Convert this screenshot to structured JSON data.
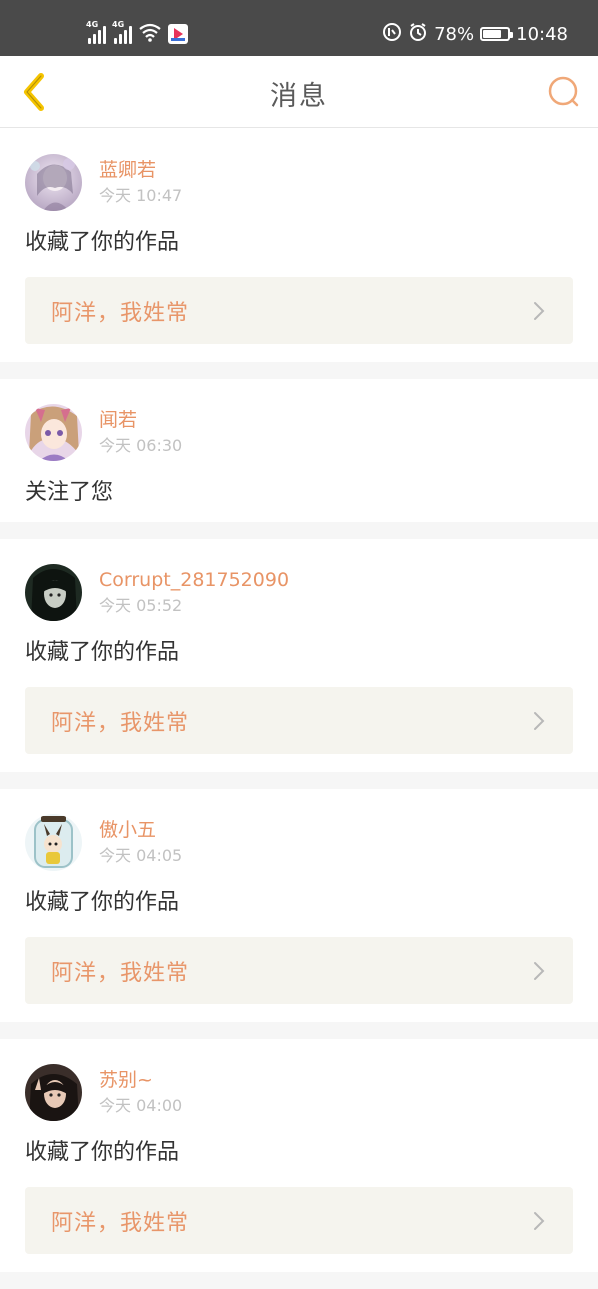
{
  "status_bar": {
    "signal1_tag": "4G",
    "signal2_tag": "4G",
    "battery_percent": "78%",
    "battery_level": 0.78,
    "time": "10:48",
    "icons": [
      "signal-icon",
      "signal-icon",
      "wifi-icon",
      "app-badge-icon",
      "data-saver-icon",
      "alarm-icon",
      "battery-icon"
    ]
  },
  "nav": {
    "title": "消息",
    "back_icon": "chevron-left-icon",
    "search_icon": "search-icon"
  },
  "colors": {
    "accent": "#e89466",
    "back_arrow": "#f5c400",
    "work_bg": "#f5f4ee",
    "divider": "#f6f6f6"
  },
  "messages": [
    {
      "username": "蓝卿若",
      "time": "今天 10:47",
      "action": "收藏了你的作品",
      "work_title": "阿洋，我姓常",
      "avatar": "avatar-lavender-girl"
    },
    {
      "username": "闻若",
      "time": "今天 06:30",
      "action": "关注了您",
      "work_title": null,
      "avatar": "avatar-anime-girl"
    },
    {
      "username": "Corrupt_281752090",
      "time": "今天 05:52",
      "action": "收藏了你的作品",
      "work_title": "阿洋，我姓常",
      "avatar": "avatar-dark-girl"
    },
    {
      "username": "傲小五",
      "time": "今天 04:05",
      "action": "收藏了你的作品",
      "work_title": "阿洋，我姓常",
      "avatar": "avatar-bunny-jar"
    },
    {
      "username": "苏别~",
      "time": "今天 04:00",
      "action": "收藏了你的作品",
      "work_title": "阿洋，我姓常",
      "avatar": "avatar-peace-girl"
    }
  ]
}
